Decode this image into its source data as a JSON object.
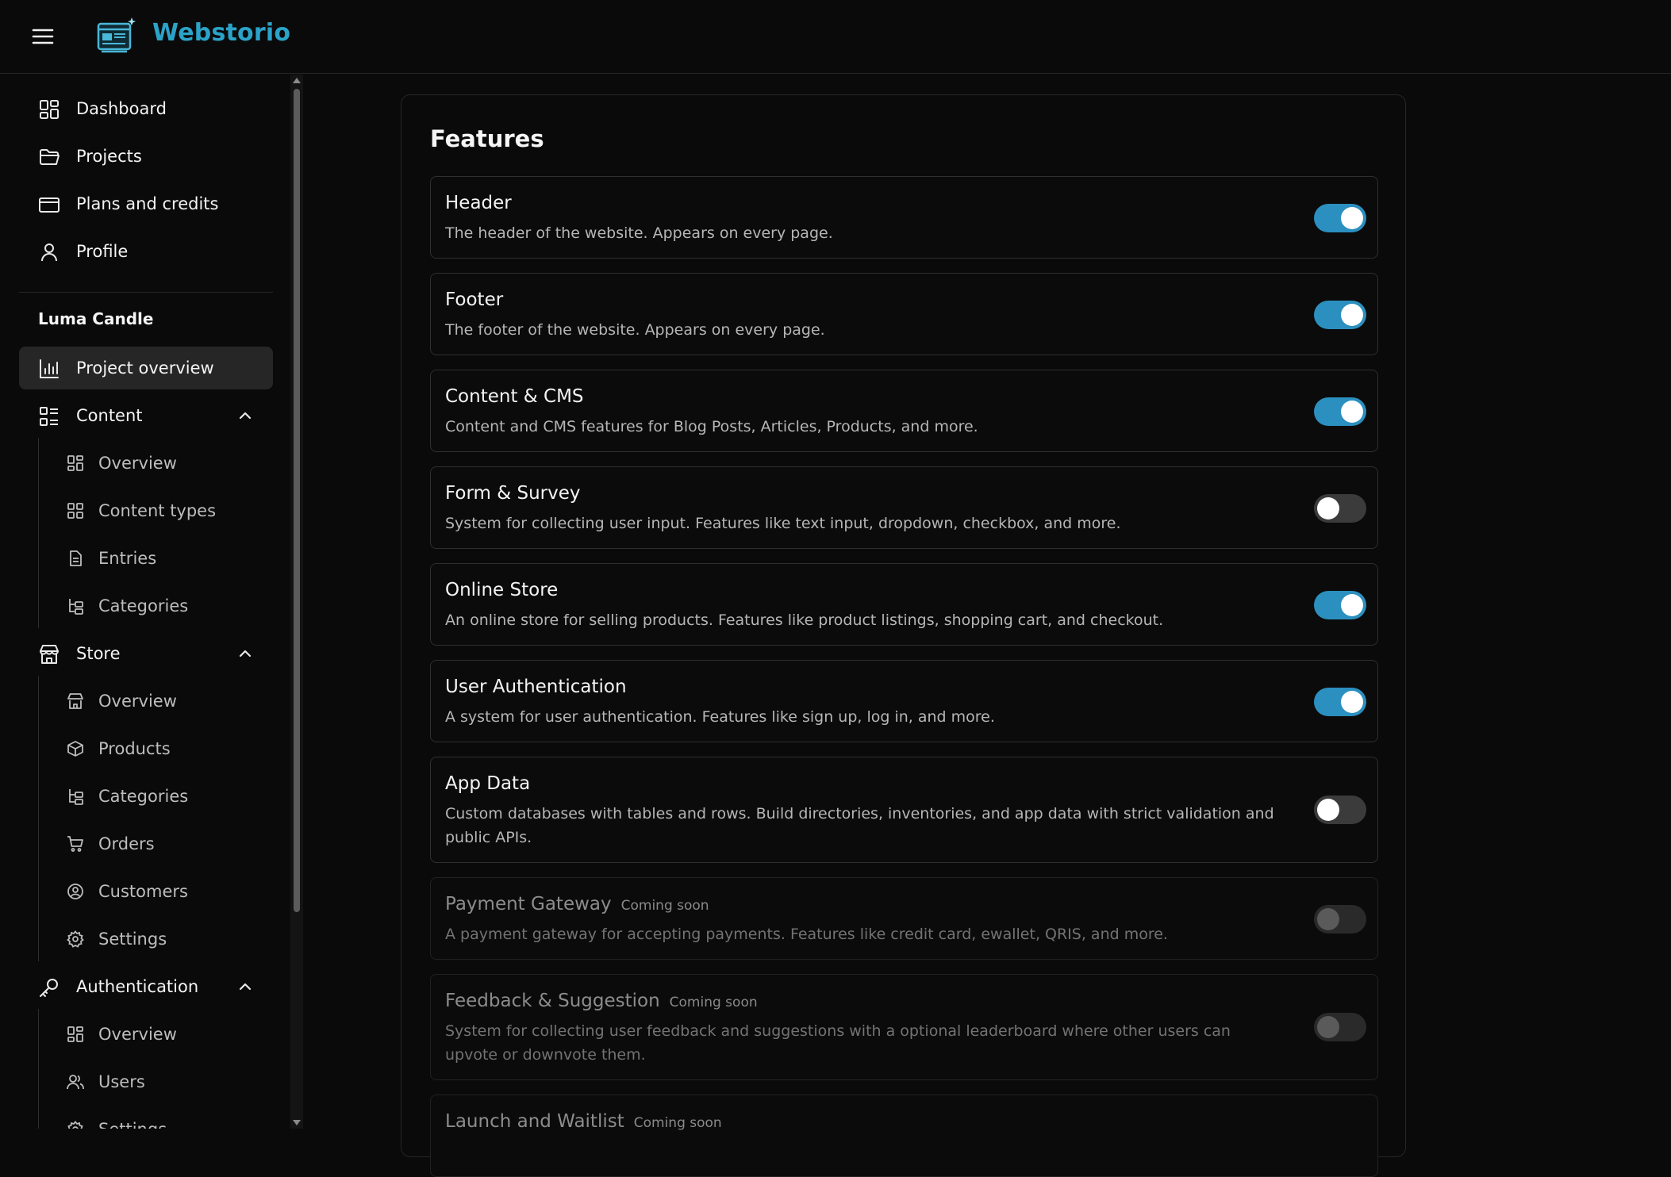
{
  "app": {
    "brand": "Webstorio"
  },
  "colors": {
    "accent": "#2ba3c9",
    "toggle_on": "#2b8fc0",
    "background": "#0a0a0a"
  },
  "sidebar": {
    "main_nav": [
      {
        "label": "Dashboard",
        "icon": "dashboard-grid-icon"
      },
      {
        "label": "Projects",
        "icon": "folder-icon"
      },
      {
        "label": "Plans and credits",
        "icon": "credit-card-icon"
      },
      {
        "label": "Profile",
        "icon": "user-icon"
      }
    ],
    "project_name": "Luma Candle",
    "project_overview": {
      "label": "Project overview",
      "icon": "bar-chart-icon"
    },
    "content": {
      "label": "Content",
      "items": [
        {
          "label": "Overview",
          "icon": "grid-icon"
        },
        {
          "label": "Content types",
          "icon": "grid-icon"
        },
        {
          "label": "Entries",
          "icon": "document-icon"
        },
        {
          "label": "Categories",
          "icon": "category-tree-icon"
        }
      ]
    },
    "store": {
      "label": "Store",
      "items": [
        {
          "label": "Overview",
          "icon": "store-icon"
        },
        {
          "label": "Products",
          "icon": "package-icon"
        },
        {
          "label": "Categories",
          "icon": "category-tree-icon"
        },
        {
          "label": "Orders",
          "icon": "shopping-cart-icon"
        },
        {
          "label": "Customers",
          "icon": "user-circle-icon"
        },
        {
          "label": "Settings",
          "icon": "gear-icon"
        }
      ]
    },
    "authentication": {
      "label": "Authentication",
      "items": [
        {
          "label": "Overview",
          "icon": "grid-icon"
        },
        {
          "label": "Users",
          "icon": "users-icon"
        },
        {
          "label": "Settings",
          "icon": "gear-icon"
        }
      ]
    }
  },
  "main": {
    "title": "Features",
    "features": [
      {
        "name": "Header",
        "description": "The header of the website. Appears on every page.",
        "enabled": true
      },
      {
        "name": "Footer",
        "description": "The footer of the website. Appears on every page.",
        "enabled": true
      },
      {
        "name": "Content & CMS",
        "description": "Content and CMS features for Blog Posts, Articles, Products, and more.",
        "enabled": true
      },
      {
        "name": "Form & Survey",
        "description": "System for collecting user input. Features like text input, dropdown, checkbox, and more.",
        "enabled": false
      },
      {
        "name": "Online Store",
        "description": "An online store for selling products. Features like product listings, shopping cart, and checkout.",
        "enabled": true
      },
      {
        "name": "User Authentication",
        "description": "A system for user authentication. Features like sign up, log in, and more.",
        "enabled": true
      },
      {
        "name": "App Data",
        "description": "Custom databases with tables and rows. Build directories, inventories, and app data with strict validation and public APIs.",
        "enabled": false
      },
      {
        "name": "Payment Gateway",
        "badge": "Coming soon",
        "description": "A payment gateway for accepting payments. Features like credit card, ewallet, QRIS, and more.",
        "enabled": false
      },
      {
        "name": "Feedback & Suggestion",
        "badge": "Coming soon",
        "description": "System for collecting user feedback and suggestions with a optional leaderboard where other users can upvote or downvote them.",
        "enabled": false
      },
      {
        "name": "Launch and Waitlist",
        "badge": "Coming soon",
        "description": "",
        "enabled": false
      }
    ]
  }
}
